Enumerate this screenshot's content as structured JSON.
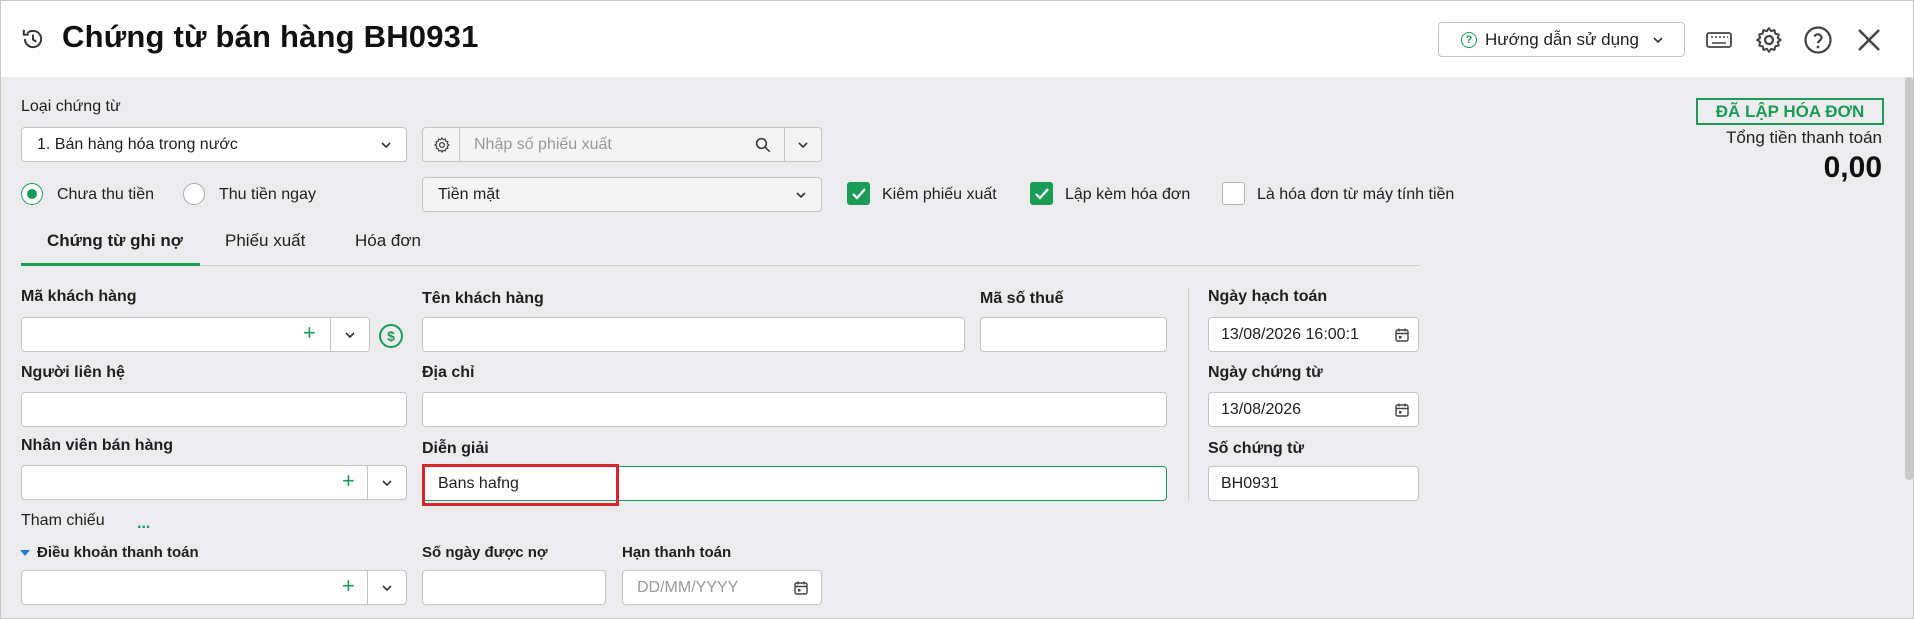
{
  "header": {
    "title": "Chứng từ bán hàng BH0931",
    "help_label": "Hướng dẫn sử dụng"
  },
  "status": {
    "badge": "ĐÃ LẬP HÓA ĐƠN",
    "total_label": "Tổng tiền thanh toán",
    "total_value": "0,00"
  },
  "voucher_type": {
    "label": "Loại chứng từ",
    "value": "1. Bán hàng hóa trong nước"
  },
  "export_search": {
    "placeholder": "Nhập số phiếu xuất"
  },
  "payment": {
    "unpaid": "Chưa thu tiền",
    "paid_now": "Thu tiền ngay",
    "method": "Tiền mặt"
  },
  "options": {
    "with_export": "Kiêm phiếu xuất",
    "with_invoice": "Lập kèm hóa đơn",
    "from_cash_register": "Là hóa đơn từ máy tính tiền"
  },
  "tabs": [
    {
      "label": "Chứng từ ghi nợ"
    },
    {
      "label": "Phiếu xuất"
    },
    {
      "label": "Hóa đơn"
    }
  ],
  "form": {
    "customer_code": "Mã khách hàng",
    "customer_name": "Tên khách hàng",
    "tax_code": "Mã số thuế",
    "contact": "Người liên hệ",
    "address": "Địa chỉ",
    "salesperson": "Nhân viên bán hàng",
    "description": "Diễn giải",
    "description_value": "Bans hafng",
    "reference": "Tham chiếu",
    "reference_link": "...",
    "payment_terms": "Điều khoản thanh toán",
    "credit_days": "Số ngày được nợ",
    "due_date": "Hạn thanh toán",
    "due_date_placeholder": "DD/MM/YYYY"
  },
  "right": {
    "posting_date_label": "Ngày hạch toán",
    "posting_date": "13/08/2026 16:00:1",
    "voucher_date_label": "Ngày chứng từ",
    "voucher_date": "13/08/2026",
    "voucher_no_label": "Số chứng từ",
    "voucher_no": "BH0931"
  },
  "colors": {
    "accent": "#1a9b57",
    "highlight": "#d9262c"
  }
}
